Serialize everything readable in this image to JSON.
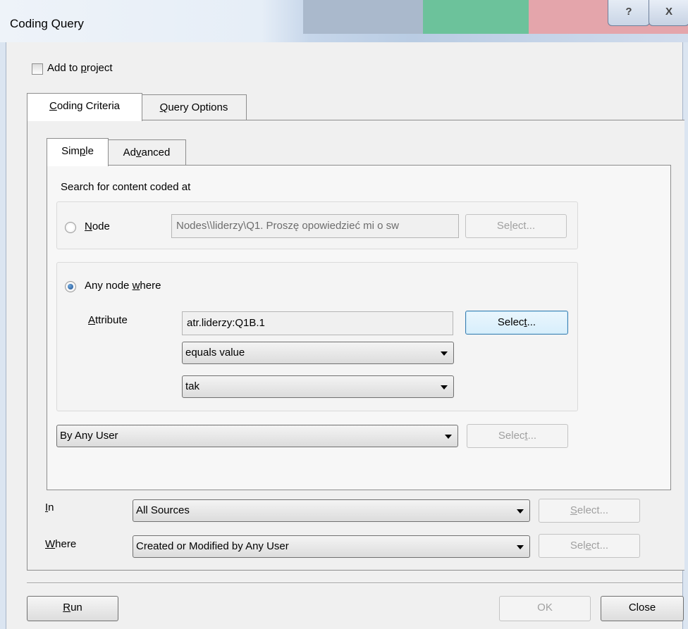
{
  "window": {
    "title": "Coding Query",
    "help_label": "?",
    "close_label": "X"
  },
  "add_to_project": {
    "label_pre": "Add to ",
    "label_key": "p",
    "label_post": "roject",
    "checked": false
  },
  "outer_tabs": [
    {
      "key": "C",
      "rest": "oding Criteria",
      "active": true
    },
    {
      "key": "Q",
      "rest": "uery Options",
      "active": false
    }
  ],
  "inner_tabs": [
    {
      "pre": "Sim",
      "key": "p",
      "post": "le",
      "active": true
    },
    {
      "pre": "Ad",
      "key": "v",
      "post": "anced",
      "active": false
    }
  ],
  "search_heading": "Search for content coded at",
  "node_option": {
    "key": "N",
    "rest": "ode",
    "selected": false,
    "value": "Nodes\\\\liderzy\\Q1. Proszę opowiedzieć mi o sw",
    "select_pre": "Se",
    "select_key": "l",
    "select_post": "ect..."
  },
  "any_node_option": {
    "pre": "Any node ",
    "key": "w",
    "post": "here",
    "selected": true,
    "attribute_key": "A",
    "attribute_rest": "ttribute",
    "attribute_value": "atr.liderzy:Q1B.1",
    "select_pre": "Selec",
    "select_key": "t",
    "select_post": "...",
    "operator": "equals value",
    "value": "tak"
  },
  "user_filter": {
    "value": "By Any User",
    "select_pre": "Selec",
    "select_key": "t",
    "select_post": "..."
  },
  "in_row": {
    "key": "I",
    "rest": "n",
    "value": "All Sources",
    "select_key": "S",
    "select_rest": "elect..."
  },
  "where_row": {
    "key": "W",
    "rest": "here",
    "value": "Created or Modified by Any User",
    "select_pre": "Sel",
    "select_key": "e",
    "select_post": "ct..."
  },
  "footer": {
    "run_key": "R",
    "run_rest": "un",
    "ok_label": "OK",
    "close_label": "Close"
  },
  "colors": {
    "accent_focus": "#3c7fb1",
    "frame": "#dbe5f1"
  }
}
